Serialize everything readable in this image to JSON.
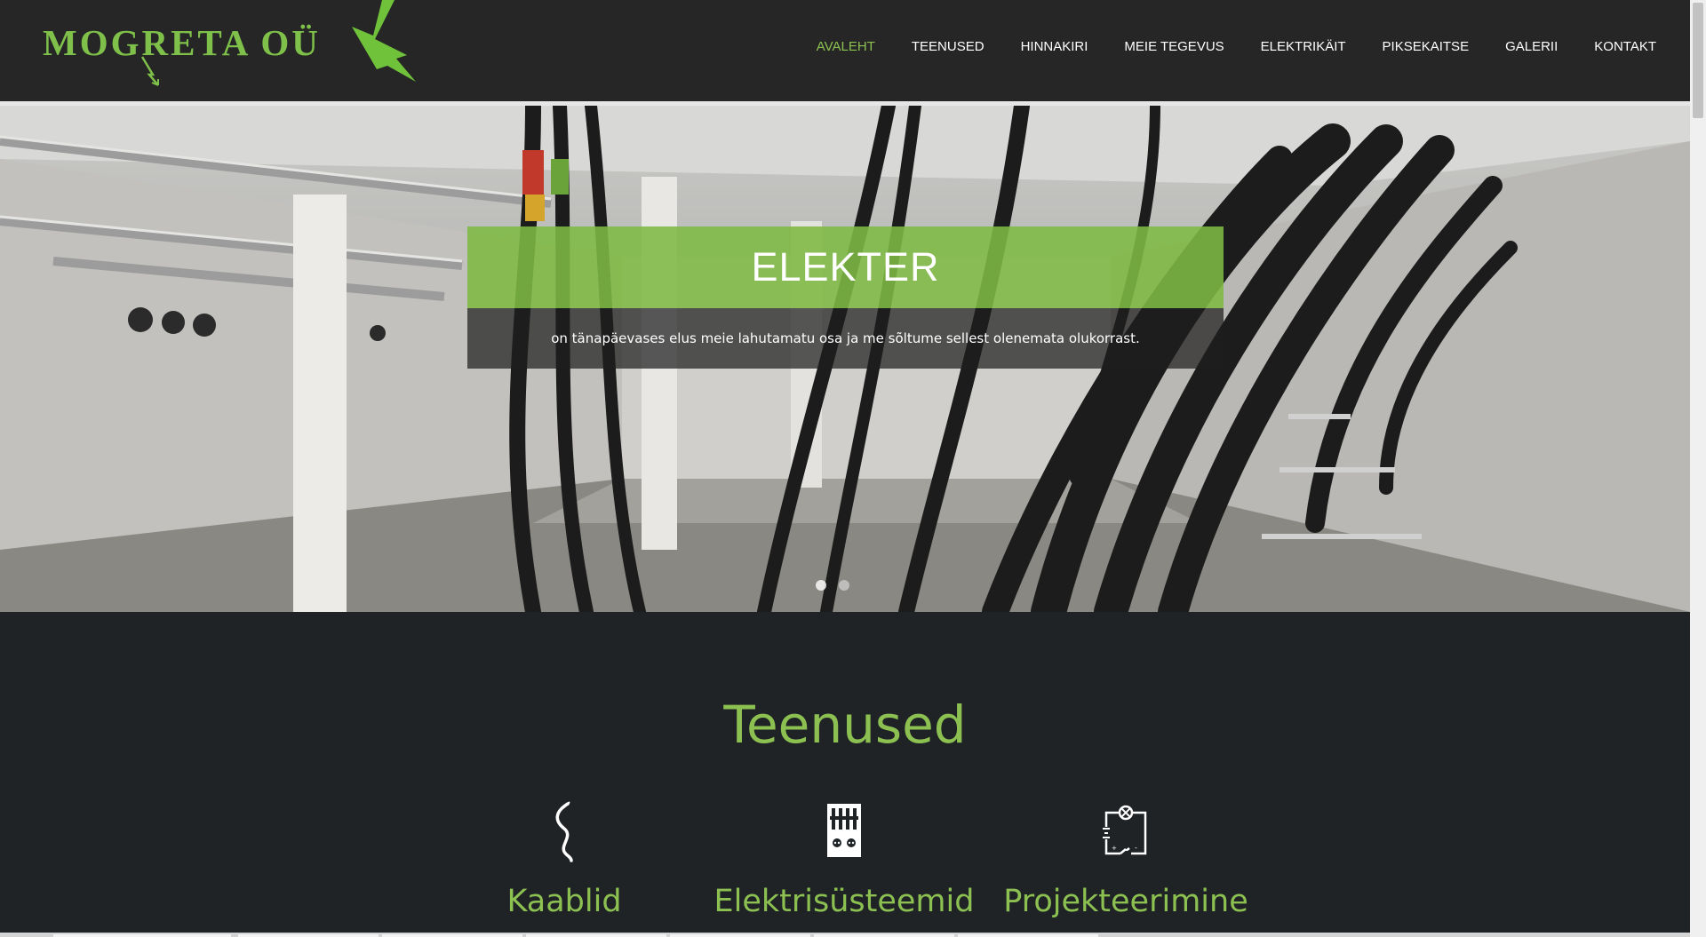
{
  "header": {
    "logo_text": "MOGRETA OÜ",
    "nav": [
      {
        "label": "AVALEHT",
        "active": true
      },
      {
        "label": "TEENUSED",
        "active": false
      },
      {
        "label": "HINNAKIRI",
        "active": false
      },
      {
        "label": "MEIE TEGEVUS",
        "active": false
      },
      {
        "label": "ELEKTRIKÄIT",
        "active": false
      },
      {
        "label": "PIKSEKAITSE",
        "active": false
      },
      {
        "label": "GALERII",
        "active": false
      },
      {
        "label": "KONTAKT",
        "active": false
      }
    ]
  },
  "hero": {
    "title": "ELEKTER",
    "subtitle": "on tänapäevases elus meie lahutamatu osa ja me sõltume sellest olenemata olukorrast.",
    "slides": 2,
    "active_slide": 1
  },
  "services": {
    "title": "Teenused",
    "items": [
      {
        "label": "Kaablid",
        "icon": "cable-icon"
      },
      {
        "label": "Elektrisüsteemid",
        "icon": "switchboard-icon"
      },
      {
        "label": "Projekteerimine",
        "icon": "circuit-plan-icon"
      }
    ]
  },
  "colors": {
    "accent": "#8cc152",
    "header_bg": "#262626",
    "body_bg": "#1f2326"
  }
}
